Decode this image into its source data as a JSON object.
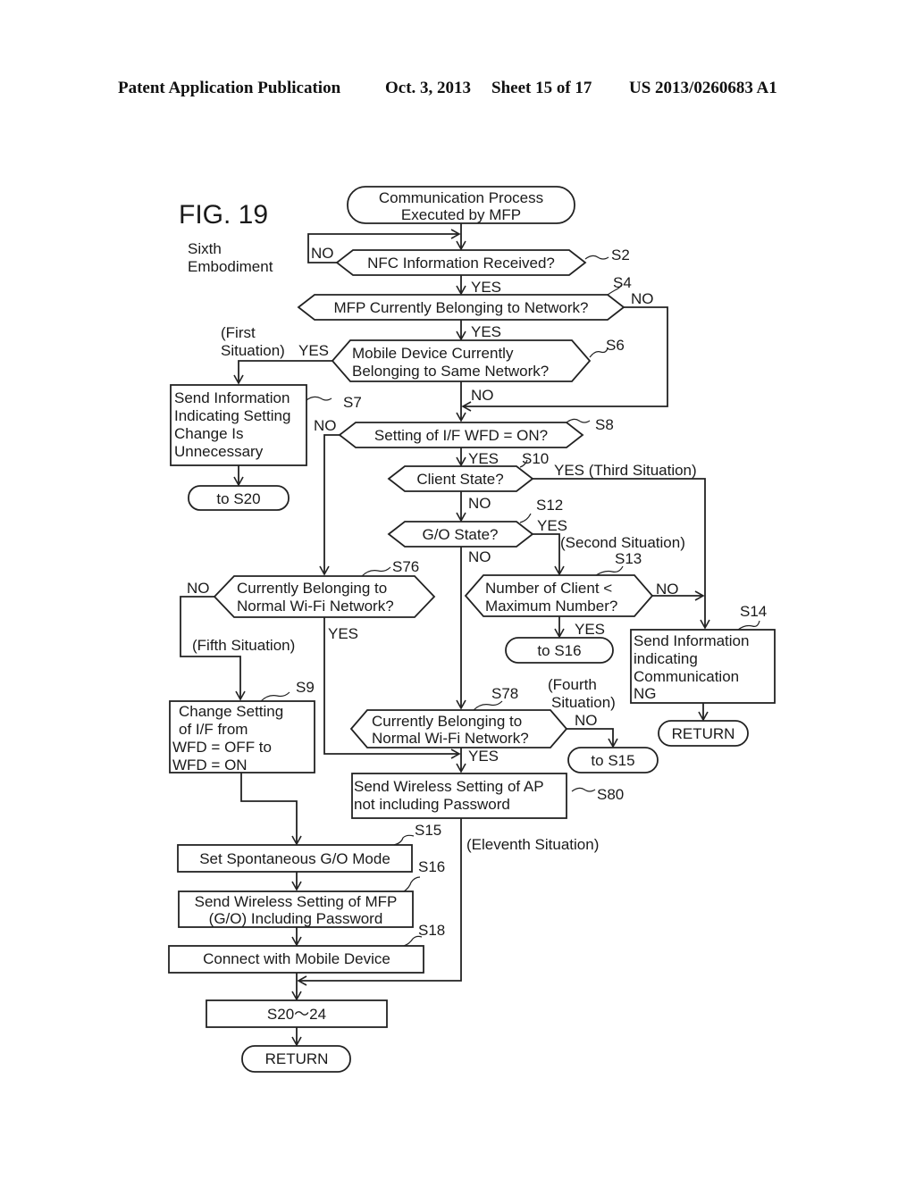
{
  "header": {
    "publication": "Patent Application Publication",
    "date": "Oct. 3, 2013",
    "sheet": "Sheet 15 of 17",
    "number": "US 2013/0260683 A1"
  },
  "figure": {
    "title": "FIG. 19",
    "subtitle_line1": "Sixth",
    "subtitle_line2": "Embodiment"
  },
  "nodes": {
    "start": {
      "line1": "Communication Process",
      "line2": "Executed by MFP"
    },
    "s2": {
      "step": "S2",
      "text": "NFC Information Received?"
    },
    "s4": {
      "step": "S4",
      "text": "MFP Currently Belonging to Network?"
    },
    "s6": {
      "step": "S6",
      "line1": "Mobile Device Currently",
      "line2": "Belonging to Same Network?"
    },
    "s7": {
      "step": "S7",
      "line1": "Send Information",
      "line2": "Indicating Setting",
      "line3": "Change Is",
      "line4": "Unnecessary"
    },
    "to_s20": {
      "text": "to S20"
    },
    "s8": {
      "step": "S8",
      "text": "Setting of I/F WFD = ON?"
    },
    "s10": {
      "step": "S10",
      "text": "Client State?"
    },
    "s12": {
      "step": "S12",
      "text": "G/O State?"
    },
    "s13": {
      "step": "S13",
      "line1": "Number of Client <",
      "line2": "Maximum Number?"
    },
    "to_s16": {
      "text": "to S16"
    },
    "s14": {
      "step": "S14",
      "line1": "Send Information",
      "line2": "indicating",
      "line3": "Communication",
      "line4": "NG"
    },
    "return1": {
      "text": "RETURN"
    },
    "s76": {
      "step": "S76",
      "line1": "Currently Belonging to",
      "line2": "Normal Wi-Fi Network?"
    },
    "s9": {
      "step": "S9",
      "line1": "Change Setting",
      "line2": "of I/F from",
      "line3": "WFD = OFF to",
      "line4": "WFD = ON"
    },
    "s78": {
      "step": "S78",
      "line1": "Currently Belonging to",
      "line2": "Normal Wi-Fi Network?"
    },
    "to_s15": {
      "text": "to S15"
    },
    "s80": {
      "step": "S80",
      "line1": "Send Wireless Setting of AP",
      "line2": "not including Password"
    },
    "s15": {
      "step": "S15",
      "text": "Set Spontaneous G/O Mode"
    },
    "s16": {
      "step": "S16",
      "line1": "Send Wireless Setting of MFP",
      "line2": "(G/O) Including Password"
    },
    "s18": {
      "step": "S18",
      "text": "Connect with Mobile Device"
    },
    "s20_24": {
      "text": "S20〜24"
    },
    "return2": {
      "text": "RETURN"
    }
  },
  "edge_labels": {
    "s2_no": "NO",
    "s2_yes": "YES",
    "s4_no": "NO",
    "s4_yes": "YES",
    "s6_yes": "YES",
    "s6_first_1": "(First",
    "s6_first_2": "Situation)",
    "s6_no": "NO",
    "s8_no": "NO",
    "s8_yes": "YES",
    "s10_yes": "YES (Third Situation)",
    "s10_no": "NO",
    "s12_yes": "YES",
    "s12_second": "(Second Situation)",
    "s12_no": "NO",
    "s13_no": "NO",
    "s13_yes": "YES",
    "s76_no": "NO",
    "s76_fifth": "(Fifth Situation)",
    "s76_yes": "YES",
    "s78_fourth_1": "(Fourth",
    "s78_fourth_2": "Situation)",
    "s78_no": "NO",
    "s78_yes": "YES",
    "eleventh": "(Eleventh Situation)"
  }
}
